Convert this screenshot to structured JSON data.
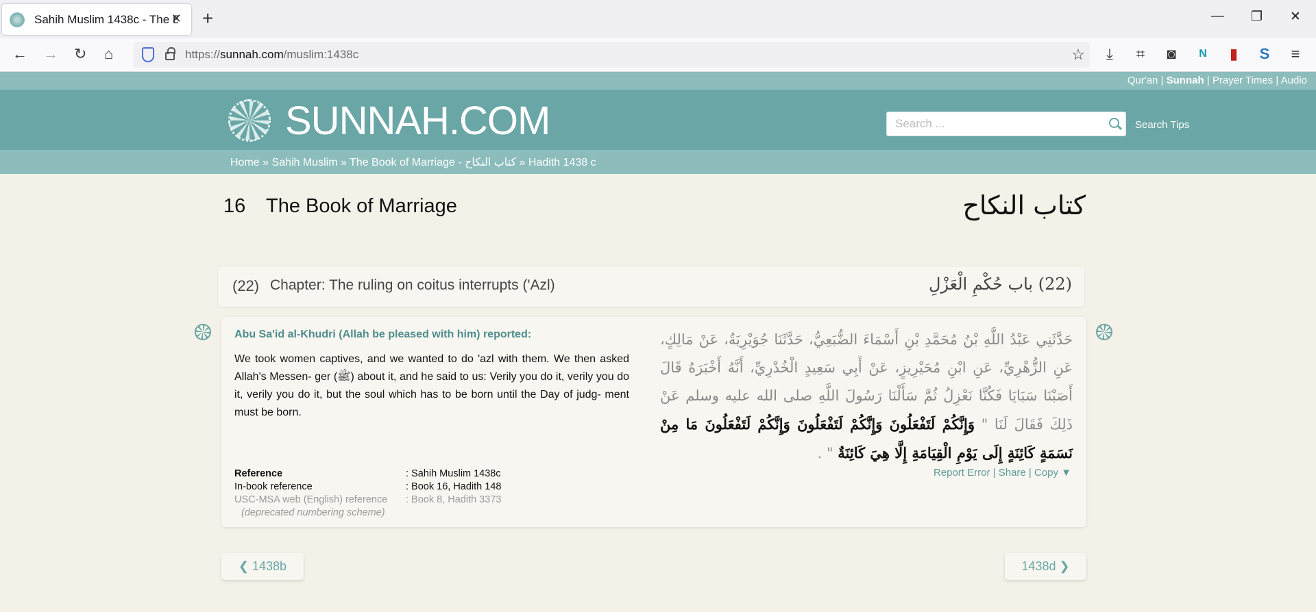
{
  "browser": {
    "tab_title": "Sahih Muslim 1438c - The Book",
    "new_tab": "+",
    "url_scheme": "https://",
    "url_host": "sunnah.com",
    "url_path": "/muslim:1438c",
    "window_controls": [
      "—",
      "❐",
      "✕"
    ]
  },
  "site": {
    "top_links": {
      "quran": "Qur'an",
      "sunnah": "Sunnah",
      "prayer": "Prayer Times",
      "audio": "Audio",
      "sep": " | "
    },
    "logo_text": "SUNNAH.COM",
    "search": {
      "placeholder": "Search ...",
      "value": ""
    },
    "search_tips": "Search Tips",
    "breadcrumb": {
      "home": "Home",
      "sep": " » ",
      "collection": "Sahih Muslim",
      "book": "The Book of Marriage - كتاب النكاح",
      "hadith": "Hadith 1438 c"
    }
  },
  "book": {
    "number": "16",
    "title": "The Book of Marriage",
    "arabic_title": "كتاب النكاح"
  },
  "chapter": {
    "number": "(22)",
    "title": "Chapter: The ruling on coitus interrupts ('Azl)",
    "arabic_title": "(22) باب حُكْمِ الْعَزْلِ"
  },
  "hadith": {
    "narrator": "Abu Sa'id al-Khudri (Allah be pleased with him) reported:",
    "english": "We took women captives, and we wanted to do 'azl with them. We then asked Allah's Messen- ger (ﷺ) about it, and he said to us: Verily you do it, verily you do it, verily you do it, but the soul which has to be born until the Day of judg- ment must be born.",
    "arabic_chain": "حَدَّثَنِي عَبْدُ اللَّهِ بْنُ مُحَمَّدِ بْنِ أَسْمَاءَ الضُّبَعِيُّ، حَدَّثَنَا جُوَيْرِيَةُ، عَنْ مَالِكٍ، عَنِ الزُّهْرِيِّ، عَنِ ابْنِ مُحَيْرِيزٍ، عَنْ أَبِي سَعِيدٍ الْخُدْرِيِّ، أَنَّهُ أَخْبَرَهُ قَالَ أَصَبْنَا سَبَايَا فَكُنَّا نَعْزِلُ ثُمَّ سَأَلْنَا رَسُولَ اللَّهِ صلى الله عليه وسلم عَنْ ذَلِكَ فَقَالَ لَنَا \" ",
    "arabic_matn": "وَإِنَّكُمْ لَتَفْعَلُونَ وَإِنَّكُمْ لَتَفْعَلُونَ وَإِنَّكُمْ لَتَفْعَلُونَ مَا مِنْ نَسَمَةٍ كَائِنَةٍ إِلَى يَوْمِ الْقِيَامَةِ إِلَّا هِيَ كَائِنَةٌ",
    "arabic_end": " \" ."
  },
  "references": {
    "reference_label": "Reference",
    "reference_value": ": Sahih Muslim 1438c",
    "inbook_label": "In-book reference",
    "inbook_value": ": Book 16, Hadith 148",
    "usc_label": "USC-MSA web (English) reference",
    "usc_value": ": Book 8, Hadith 3373",
    "deprecated_note": "(deprecated numbering scheme)"
  },
  "actions": {
    "report": "Report Error",
    "share": "Share",
    "copy": "Copy ▼",
    "sep": " | "
  },
  "pager": {
    "prev": "1438b",
    "next": "1438d"
  }
}
